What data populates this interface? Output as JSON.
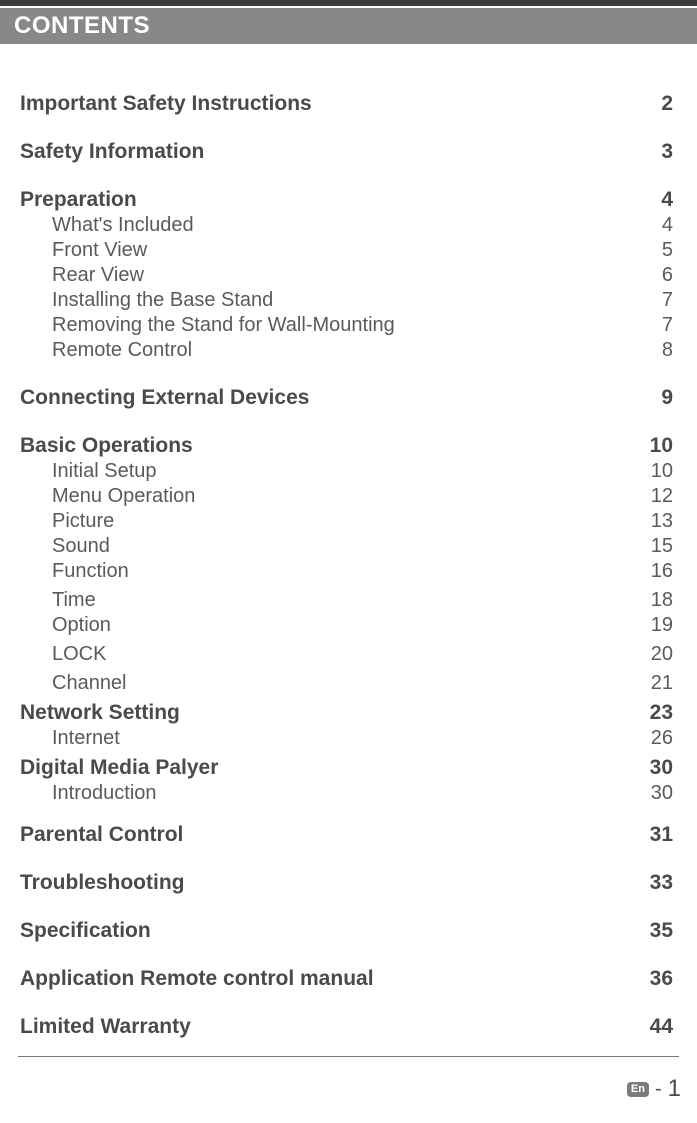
{
  "header": "CONTENTS",
  "toc": [
    {
      "type": "section",
      "title": "Important Safety Instructions",
      "page": "2"
    },
    {
      "type": "section",
      "title": "Safety Information",
      "page": "3"
    },
    {
      "type": "section",
      "title": "Preparation",
      "page": "4"
    },
    {
      "type": "sub",
      "title": "What's Included",
      "page": "4"
    },
    {
      "type": "sub",
      "title": "Front View",
      "page": "5"
    },
    {
      "type": "sub",
      "title": "Rear View",
      "page": "6"
    },
    {
      "type": "sub",
      "title": "Installing the Base Stand",
      "page": "7"
    },
    {
      "type": "sub",
      "title": "Removing the Stand for Wall-Mounting",
      "page": "7"
    },
    {
      "type": "sub",
      "title": "Remote Control",
      "page": "8"
    },
    {
      "type": "section",
      "title": "Connecting External Devices",
      "page": "9"
    },
    {
      "type": "section",
      "title": "Basic Operations",
      "page": "10"
    },
    {
      "type": "sub",
      "title": "Initial Setup",
      "page": "10"
    },
    {
      "type": "sub",
      "title": "Menu Operation",
      "page": "12"
    },
    {
      "type": "sub",
      "title": "Picture",
      "page": "13"
    },
    {
      "type": "sub",
      "title": "Sound",
      "page": "15"
    },
    {
      "type": "sub",
      "title": "Function",
      "page": "16"
    },
    {
      "type": "sub-wide",
      "title": "Time",
      "page": "18"
    },
    {
      "type": "sub",
      "title": "Option",
      "page": "19"
    },
    {
      "type": "sub-wide",
      "title": "LOCK",
      "page": "20"
    },
    {
      "type": "sub-wide",
      "title": "Channel",
      "page": "21"
    },
    {
      "type": "section-tight",
      "title": "Network Setting",
      "page": "23"
    },
    {
      "type": "sub",
      "title": "Internet",
      "page": "26"
    },
    {
      "type": "section-tight",
      "title": "Digital Media Palyer",
      "page": "30"
    },
    {
      "type": "sub",
      "title": "Introduction",
      "page": "30"
    },
    {
      "type": "section",
      "title": "Parental Control",
      "page": "31"
    },
    {
      "type": "section",
      "title": "Troubleshooting",
      "page": "33"
    },
    {
      "type": "section",
      "title": "Specification",
      "page": "35"
    },
    {
      "type": "section",
      "title": "Application Remote control manual",
      "page": "36"
    },
    {
      "type": "section",
      "title": "Limited Warranty",
      "page": "44"
    }
  ],
  "footer": {
    "lang": "En",
    "dash": "-",
    "page": "1"
  }
}
